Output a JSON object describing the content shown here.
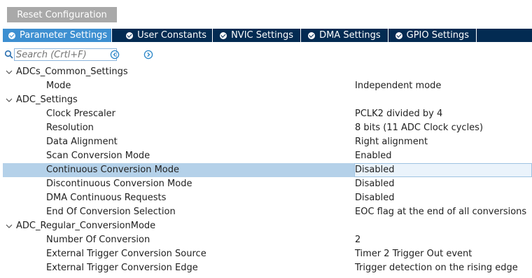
{
  "toolbar": {
    "reset_label": "Reset Configuration"
  },
  "tabs": [
    {
      "label": "Parameter Settings",
      "active": true
    },
    {
      "label": "User Constants",
      "active": false
    },
    {
      "label": "NVIC Settings",
      "active": false
    },
    {
      "label": "DMA Settings",
      "active": false
    },
    {
      "label": "GPIO Settings",
      "active": false
    }
  ],
  "search": {
    "placeholder": "Search (Crtl+F)",
    "value": ""
  },
  "icons": {
    "search": "search-icon",
    "prev": "chevron-left-circle-icon",
    "next": "chevron-right-circle-icon",
    "expand": "chevron-down-icon",
    "tab_status": "check-circle-icon"
  },
  "colors": {
    "tabbar": "#032b52",
    "active_tab": "#3d8fd1",
    "selected_row": "#b4d1e9",
    "reset_button": "#a9a9a9"
  },
  "tree": [
    {
      "type": "group",
      "label": "ADCs_Common_Settings"
    },
    {
      "type": "param",
      "label": "Mode",
      "value": "Independent mode"
    },
    {
      "type": "group",
      "label": "ADC_Settings"
    },
    {
      "type": "param",
      "label": "Clock Prescaler",
      "value": "PCLK2 divided by 4"
    },
    {
      "type": "param",
      "label": "Resolution",
      "value": "8 bits (11 ADC Clock cycles)"
    },
    {
      "type": "param",
      "label": "Data Alignment",
      "value": "Right alignment"
    },
    {
      "type": "param",
      "label": "Scan Conversion Mode",
      "value": "Enabled"
    },
    {
      "type": "param",
      "label": "Continuous Conversion Mode",
      "value": "Disabled",
      "selected": true
    },
    {
      "type": "param",
      "label": "Discontinuous Conversion Mode",
      "value": "Disabled"
    },
    {
      "type": "param",
      "label": "DMA Continuous Requests",
      "value": "Disabled"
    },
    {
      "type": "param",
      "label": "End Of Conversion Selection",
      "value": "EOC flag at the end of all conversions"
    },
    {
      "type": "group",
      "label": "ADC_Regular_ConversionMode"
    },
    {
      "type": "param",
      "label": "Number Of Conversion",
      "value": "2"
    },
    {
      "type": "param",
      "label": "External Trigger Conversion Source",
      "value": "Timer 2 Trigger Out event"
    },
    {
      "type": "param",
      "label": "External Trigger Conversion Edge",
      "value": "Trigger detection on the rising edge"
    }
  ]
}
